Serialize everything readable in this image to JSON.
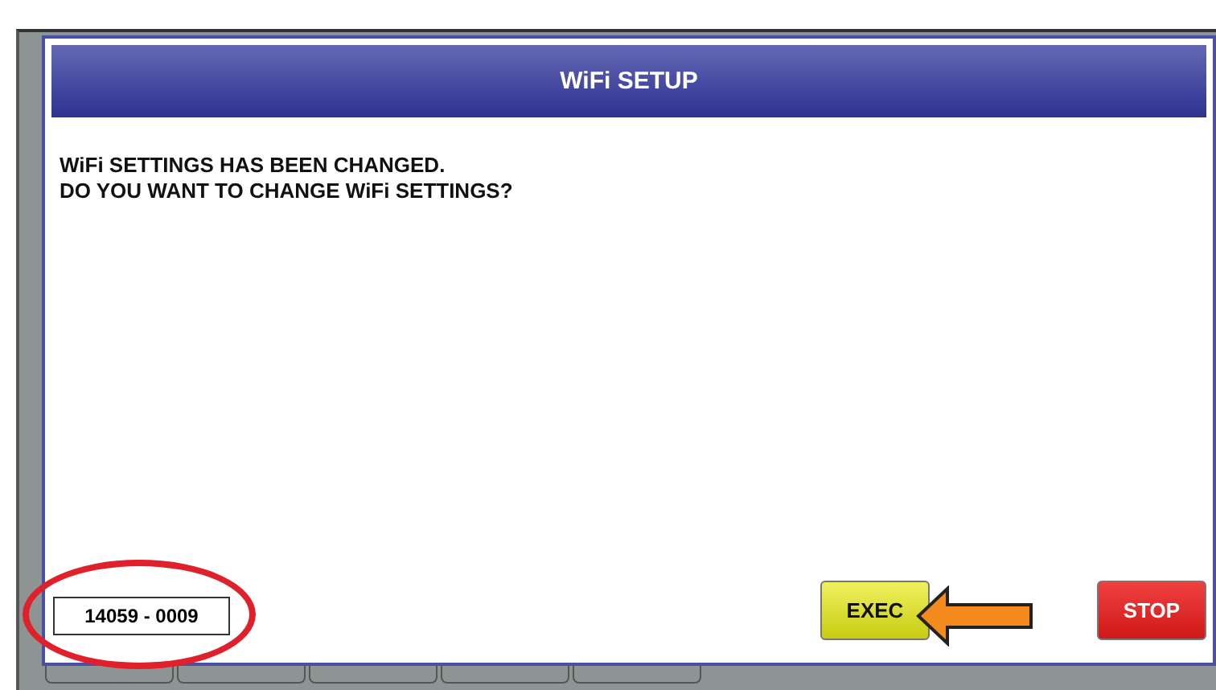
{
  "dialog": {
    "title": "WiFi SETUP",
    "message_lines": [
      "WiFi SETTINGS HAS BEEN CHANGED.",
      "DO YOU WANT TO CHANGE WiFi SETTINGS?"
    ],
    "code": "14059 - 0009",
    "buttons": [
      {
        "label": "EXEC",
        "kind": "exec"
      },
      {
        "label": "STOP",
        "kind": "stop"
      }
    ]
  }
}
